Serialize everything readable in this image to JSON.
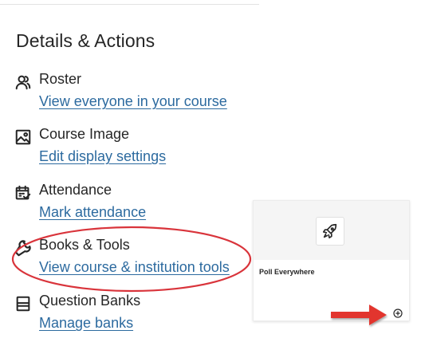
{
  "panel": {
    "title": "Details & Actions",
    "items": [
      {
        "icon": "roster-icon",
        "label": "Roster",
        "link": "View everyone in your course"
      },
      {
        "icon": "image-icon",
        "label": "Course Image",
        "link": "Edit display settings"
      },
      {
        "icon": "attendance-icon",
        "label": "Attendance",
        "link": "Mark attendance"
      },
      {
        "icon": "wrench-icon",
        "label": "Books & Tools",
        "link": "View course & institution tools"
      },
      {
        "icon": "question-bank-icon",
        "label": "Question Banks",
        "link": "Manage banks"
      }
    ]
  },
  "tool_card": {
    "logo_icon": "rocket-icon",
    "name": "Poll Everywhere",
    "action_icon": "plus-circle-icon"
  },
  "annotations": {
    "highlight_color": "#d9343b",
    "arrow_color": "#e2342e"
  },
  "colors": {
    "link": "#2c6a9f",
    "text": "#262626"
  }
}
